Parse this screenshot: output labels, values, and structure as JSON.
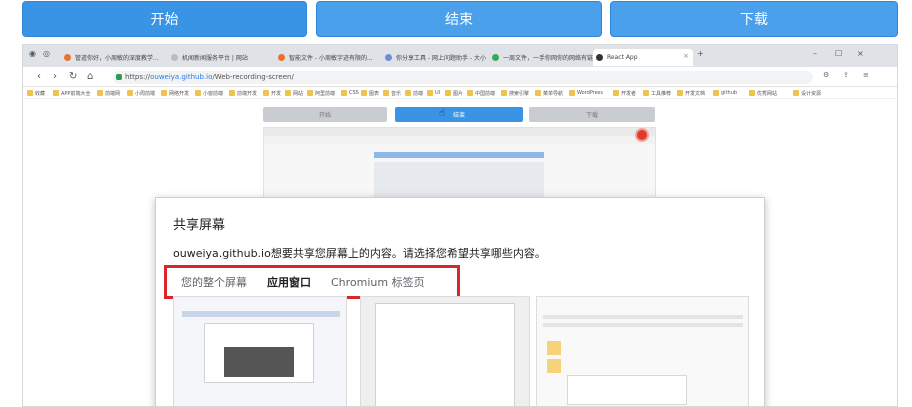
{
  "toolbar": {
    "start_label": "开始",
    "end_label": "结束",
    "download_label": "下载"
  },
  "browser": {
    "tabs": [
      {
        "title": "管道你好，小周敏的深度教学..."
      },
      {
        "title": "机闻新闻服务平台 | 网站"
      },
      {
        "title": "智能文件 - 小周敏字迹有限的..."
      },
      {
        "title": "你分享工具 - 网上问题助手 - 大小..."
      },
      {
        "title": "一周文件，一手你网你的网络有链"
      },
      {
        "title": "React App"
      }
    ],
    "url_scheme": "https://",
    "url_host": "ouweiya.github.io",
    "url_path": "/Web-recording-screen/",
    "bookmarks": [
      "收藏",
      "APP前端大全",
      "前端网",
      "小周前端",
      "网络开发",
      "小窗前端",
      "前端开发",
      "开发",
      "网站",
      "阿里前端",
      "CSS",
      "图表",
      "音乐",
      "前端",
      "UI",
      "图片",
      "中国前端",
      "搜索引擎",
      "菜单导航",
      "WordPress",
      "开发者",
      "工具推荐",
      "开发文档",
      "github",
      "优秀网站",
      "设计资源"
    ]
  },
  "nested_app": {
    "start_label": "开始",
    "end_label": "结束",
    "download_label": "下载"
  },
  "share_dialog": {
    "title": "共享屏幕",
    "description": "ouweiya.github.io想要共享您屏幕上的内容。请选择您希望共享哪些内容。",
    "tabs": [
      {
        "label": "您的整个屏幕"
      },
      {
        "label": "应用窗口"
      },
      {
        "label": "Chromium 标签页"
      }
    ],
    "highlight_color": "#d9262b"
  },
  "colors": {
    "primary_button": "#3a94e6"
  }
}
